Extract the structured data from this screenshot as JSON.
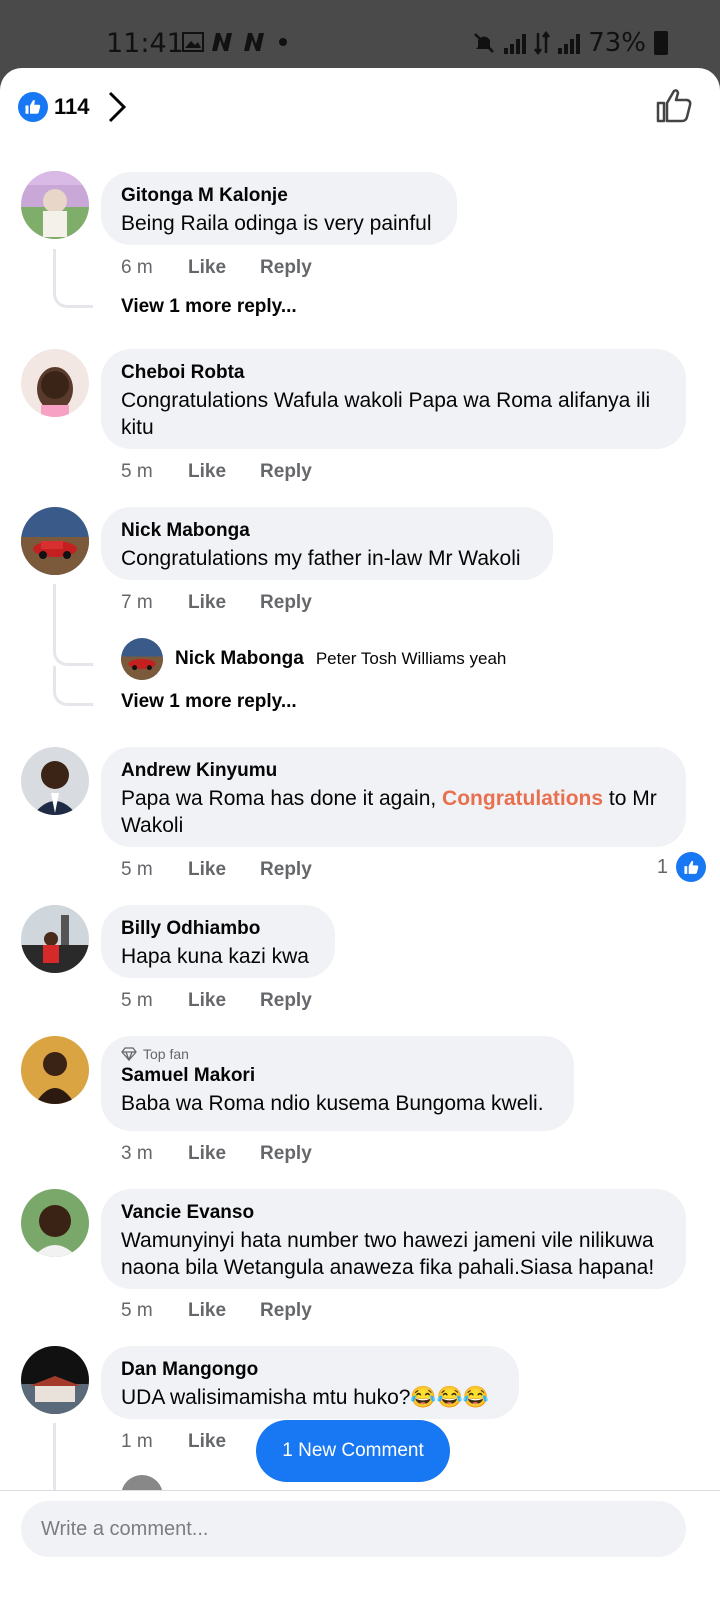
{
  "status_bar": {
    "time": "11:41",
    "battery": "73%",
    "icons": [
      "image-icon",
      "n-app-icon",
      "n-app-icon",
      "dot-icon",
      "mute-icon",
      "signal-icon",
      "data-icon",
      "signal-icon",
      "battery-icon"
    ]
  },
  "header": {
    "like_count": "114",
    "icons": [
      "like-badge-icon",
      "chevron-right-icon",
      "thumbs-up-outline-icon"
    ]
  },
  "comments": [
    {
      "author": "Gitonga M Kalonje",
      "text": "Being Raila odinga is very painful",
      "time": "6 m",
      "like": "Like",
      "reply": "Reply",
      "more": "View 1 more reply..."
    },
    {
      "author": "Cheboi Robta",
      "text": "Congratulations Wafula wakoli Papa wa Roma alifanya ili kitu",
      "time": "5 m",
      "like": "Like",
      "reply": "Reply"
    },
    {
      "author": "Nick Mabonga",
      "text": "Congratulations my father in-law Mr Wakoli",
      "time": "7 m",
      "like": "Like",
      "reply": "Reply",
      "reply_preview": {
        "author": "Nick Mabonga",
        "text": "Peter Tosh Williams yeah"
      },
      "more": "View 1 more reply..."
    },
    {
      "author": "Andrew Kinyumu",
      "text_before": "Papa wa Roma has done it again, ",
      "text_highlight": "Congratulations",
      "text_after": " to Mr Wakoli",
      "time": "5 m",
      "like": "Like",
      "reply": "Reply",
      "reactions": "1"
    },
    {
      "author": "Billy Odhiambo",
      "text": "Hapa kuna kazi kwa",
      "time": "5 m",
      "like": "Like",
      "reply": "Reply"
    },
    {
      "badge": "Top fan",
      "author": "Samuel Makori",
      "text": "Baba wa Roma ndio kusema Bungoma kweli.",
      "time": "3 m",
      "like": "Like",
      "reply": "Reply"
    },
    {
      "author": "Vancie Evanso",
      "text": "Wamunyinyi hata number two hawezi jameni vile nilikuwa naona bila Wetangula anaweza fika pahali.Siasa hapana!",
      "time": "5 m",
      "like": "Like",
      "reply": "Reply"
    },
    {
      "author": "Dan Mangongo",
      "text": "UDA walisimamisha mtu huko?😂😂😂",
      "time": "1 m",
      "like": "Like"
    }
  ],
  "new_comment_button": "1 New Comment",
  "composer": {
    "placeholder": "Write a comment..."
  },
  "colors": {
    "facebook_blue": "#1877f2",
    "bubble": "#f0f2f5",
    "secondary_text": "#65676b",
    "highlight": "#e8704f"
  }
}
